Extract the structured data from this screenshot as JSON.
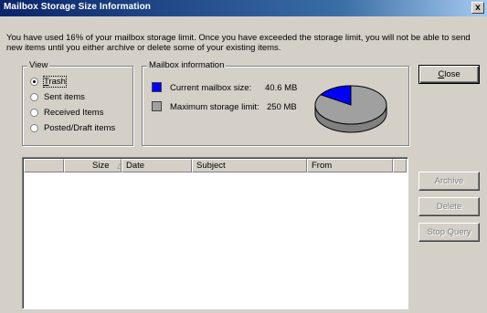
{
  "window": {
    "title": "Mailbox Storage Size Information",
    "close_glyph": "x"
  },
  "message": "You have used 16% of your mailbox storage limit.  Once you have exceeded the storage limit, you will not be able to send new items until you either archive or delete some of your existing items.",
  "view": {
    "legend": "View",
    "options": [
      {
        "label": "Trash",
        "checked": true
      },
      {
        "label": "Sent items",
        "checked": false
      },
      {
        "label": "Received Items",
        "checked": false
      },
      {
        "label": "Posted/Draft items",
        "checked": false
      }
    ]
  },
  "mailbox_info": {
    "legend": "Mailbox information",
    "current_label": "Current mailbox size:",
    "current_value": "40.6 MB",
    "current_color": "#0000ff",
    "max_label": "Maximum storage limit:",
    "max_value": "250 MB",
    "max_color": "#a0a0a0",
    "used_fraction": 0.16
  },
  "list": {
    "columns": [
      "",
      "Size",
      "Date",
      "Subject",
      "From",
      ""
    ],
    "sort_indicator": "△",
    "rows": []
  },
  "buttons": {
    "close": "Close",
    "archive": "Archive",
    "delete": "Delete",
    "stop_query": "Stop Query"
  }
}
